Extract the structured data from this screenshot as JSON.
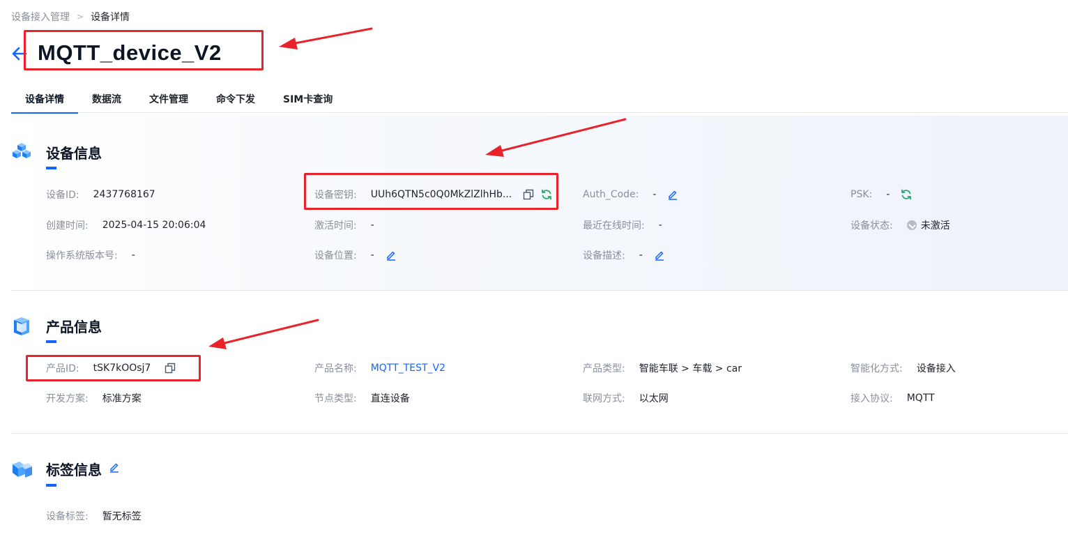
{
  "breadcrumb": {
    "root": "设备接入管理",
    "separator": ">",
    "current": "设备详情"
  },
  "device_name": "MQTT_device_V2",
  "tabs": [
    {
      "label": "设备详情",
      "active": true
    },
    {
      "label": "数据流",
      "active": false
    },
    {
      "label": "文件管理",
      "active": false
    },
    {
      "label": "命令下发",
      "active": false
    },
    {
      "label": "SIM卡查询",
      "active": false
    }
  ],
  "device_info": {
    "title": "设备信息",
    "device_id": {
      "label": "设备ID:",
      "value": "2437768167"
    },
    "device_secret": {
      "label": "设备密钥:",
      "value": "UUh6QTN5c0Q0MkZlZlhHb..."
    },
    "auth_code": {
      "label": "Auth_Code:",
      "value": "-"
    },
    "psk": {
      "label": "PSK:",
      "value": "-"
    },
    "created_time": {
      "label": "创建时间:",
      "value": "2025-04-15 20:06:04"
    },
    "activated_time": {
      "label": "激活时间:",
      "value": "-"
    },
    "last_online": {
      "label": "最近在线时间:",
      "value": "-"
    },
    "status": {
      "label": "设备状态:",
      "value": "未激活"
    },
    "os_version": {
      "label": "操作系统版本号:",
      "value": "-"
    },
    "location": {
      "label": "设备位置:",
      "value": "-"
    },
    "description": {
      "label": "设备描述:",
      "value": "-"
    }
  },
  "product_info": {
    "title": "产品信息",
    "product_id": {
      "label": "产品ID:",
      "value": "tSK7kOOsj7"
    },
    "product_name": {
      "label": "产品名称:",
      "value": "MQTT_TEST_V2"
    },
    "product_type": {
      "label": "产品类型:",
      "value": "智能车联 > 车载 > car"
    },
    "smart_mode": {
      "label": "智能化方式:",
      "value": "设备接入"
    },
    "dev_plan": {
      "label": "开发方案:",
      "value": "标准方案"
    },
    "node_type": {
      "label": "节点类型:",
      "value": "直连设备"
    },
    "network": {
      "label": "联网方式:",
      "value": "以太网"
    },
    "protocol": {
      "label": "接入协议:",
      "value": "MQTT"
    }
  },
  "tag_info": {
    "title": "标签信息",
    "device_tags": {
      "label": "设备标签:",
      "value": "暂无标签"
    }
  },
  "colors": {
    "accent": "#1664ff",
    "refresh": "#2ba471",
    "annotation": "#e8232b"
  }
}
